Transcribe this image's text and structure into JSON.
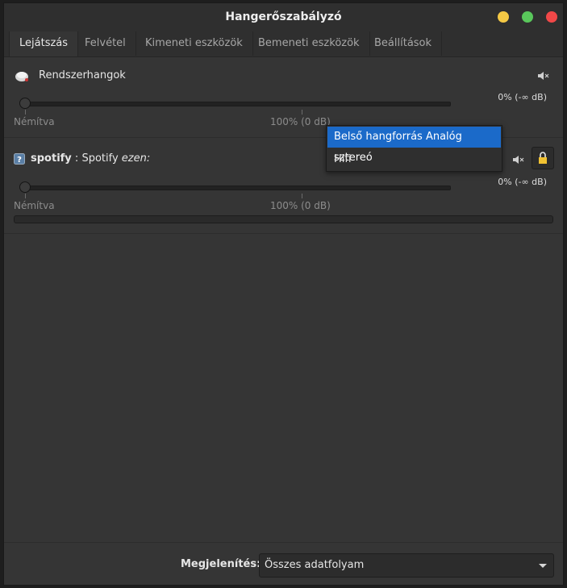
{
  "window": {
    "title": "Hangerőszabályzó"
  },
  "tabs": [
    {
      "label": "Lejátszás",
      "active": true
    },
    {
      "label": "Felvétel",
      "active": false
    },
    {
      "label": "Kimeneti eszközök",
      "active": false
    },
    {
      "label": "Bemeneti eszközök",
      "active": false
    },
    {
      "label": "Beállítások",
      "active": false
    }
  ],
  "streams": [
    {
      "name": "Rendszerhangok",
      "volume_text": "0% (-∞ dB)",
      "volume_fraction": 0,
      "scale_left": "Némítva",
      "scale_mid": "100% (0 dB)",
      "icon": "speaker-app-icon"
    },
    {
      "app": "spotify",
      "separator": " : ",
      "description": "Spotify",
      "on_label": "ezen:",
      "volume_text": "0% (-∞ dB)",
      "volume_fraction": 0,
      "scale_left": "Némítva",
      "scale_mid": "100% (0 dB)",
      "icon": "unknown-app-icon"
    }
  ],
  "device_menu": {
    "items": [
      {
        "label": "Belső hangforrás Analóg sztereó",
        "selected": true
      },
      {
        "label": "Hifi",
        "selected": false
      }
    ]
  },
  "bottom": {
    "show_label": "Megjelenítés:",
    "show_value": "Összes adatfolyam"
  },
  "colors": {
    "accent": "#1b6ac9",
    "window_bg": "#353535",
    "close": "#f14848",
    "minimize": "#f5c945",
    "maximize": "#59c75b"
  }
}
